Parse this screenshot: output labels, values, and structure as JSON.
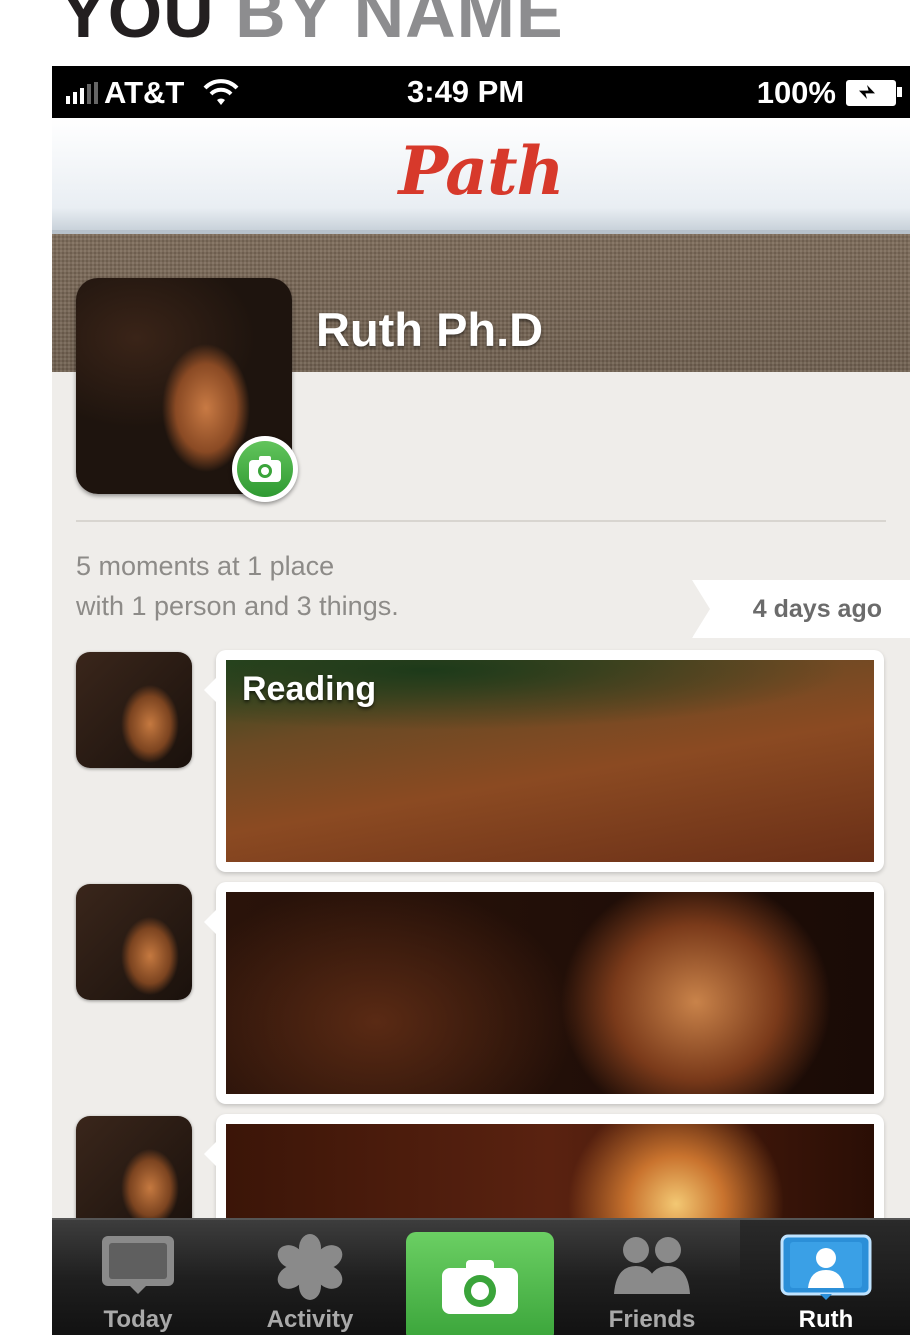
{
  "headline": {
    "dark": "YOU",
    "grey": " BY NAME"
  },
  "status_bar": {
    "carrier": "AT&T",
    "time": "3:49 PM",
    "battery": "100%"
  },
  "nav": {
    "logo": "Path"
  },
  "profile": {
    "name": "Ruth Ph.D"
  },
  "summary": {
    "line1": "5 moments at 1 place",
    "line2": "with 1 person and 3 things.",
    "time_ago": "4 days ago"
  },
  "moments": [
    {
      "title": "Reading"
    },
    {
      "title": ""
    },
    {
      "title": ""
    }
  ],
  "tabbar": {
    "tabs": [
      {
        "label": "Today",
        "icon": "tv-icon"
      },
      {
        "label": "Activity",
        "icon": "asterisk-icon"
      },
      {
        "label": "",
        "icon": "camera-icon"
      },
      {
        "label": "Friends",
        "icon": "people-icon"
      },
      {
        "label": "Ruth",
        "icon": "profile-icon"
      }
    ],
    "active": "Ruth"
  },
  "colors": {
    "brand": "#d7392b",
    "camera_green": "#3aa43a"
  }
}
